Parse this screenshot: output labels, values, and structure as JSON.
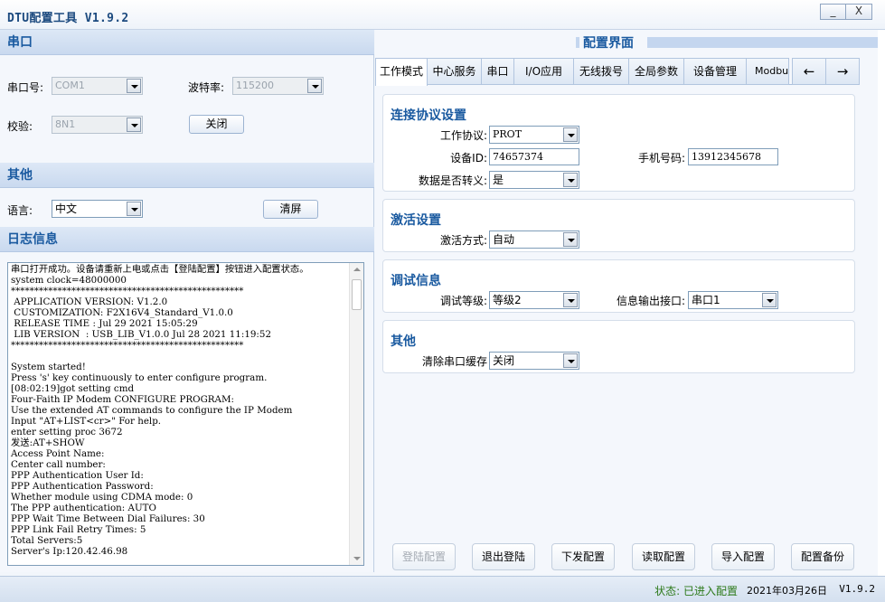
{
  "window": {
    "title": "DTU配置工具 V1.9.2",
    "minimize_glyph": "_",
    "close_glyph": "X"
  },
  "left": {
    "serial_section": "串口",
    "port_label": "串口号:",
    "port_value": "COM1",
    "baud_label": "波特率:",
    "baud_value": "115200",
    "parity_label": "校验:",
    "parity_value": "8N1",
    "close_button": "关闭",
    "other_section": "其他",
    "language_label": "语言:",
    "language_value": "中文",
    "clear_button": "清屏",
    "log_section": "日志信息",
    "log_text": "串口打开成功。设备请重新上电或点击【登陆配置】按钮进入配置状态。\nsystem clock=48000000\n**************************************************\n APPLICATION VERSION: V1.2.0\n CUSTOMIZATION: F2X16V4_Standard_V1.0.0\n RELEASE TIME : Jul 29 2021 15:05:29\n LIB VERSION  : USB_LIB_V1.0.0 Jul 28 2021 11:19:52\n**************************************************\n\nSystem started!\nPress 's' key continuously to enter configure program.\n[08:02:19]got setting cmd\nFour-Faith IP Modem CONFIGURE PROGRAM:\nUse the extended AT commands to configure the IP Modem\nInput \"AT+LIST<cr>\" For help.\nenter setting proc 3672\n发送:AT+SHOW\nAccess Point Name:\nCenter call number:\nPPP Authentication User Id:\nPPP Authentication Password:\nWhether module using CDMA mode: 0\nThe PPP authentication: AUTO\nPPP Wait Time Between Dial Failures: 30\nPPP Link Fail Retry Times: 5\nTotal Servers:5\nServer's Ip:120.42.46.98"
  },
  "right": {
    "title": "配置界面",
    "tabs": [
      "工作模式",
      "中心服务",
      "串口",
      "I/O应用",
      "无线拨号",
      "全局参数",
      "设备管理",
      "Modbus"
    ],
    "prev_glyph": "←",
    "next_glyph": "→",
    "conn": {
      "title": "连接协议设置",
      "protocol_label": "工作协议:",
      "protocol_value": "PROT",
      "device_id_label": "设备ID:",
      "device_id_value": "74657374",
      "phone_label": "手机号码:",
      "phone_value": "13912345678",
      "escape_label": "数据是否转义:",
      "escape_value": "是"
    },
    "activate": {
      "title": "激活设置",
      "mode_label": "激活方式:",
      "mode_value": "自动"
    },
    "debug": {
      "title": "调试信息",
      "level_label": "调试等级:",
      "level_value": "等级2",
      "port_label": "信息输出接口:",
      "port_value": "串口1"
    },
    "other": {
      "title": "其他",
      "clear_label": "清除串口缓存",
      "clear_value": "关闭"
    },
    "buttons": {
      "login": "登陆配置",
      "logout": "退出登陆",
      "send": "下发配置",
      "read": "读取配置",
      "import": "导入配置",
      "backup": "配置备份"
    }
  },
  "status": {
    "state": "状态: 已进入配置",
    "date": "2021年03月26日",
    "version": "V1.9.2"
  }
}
